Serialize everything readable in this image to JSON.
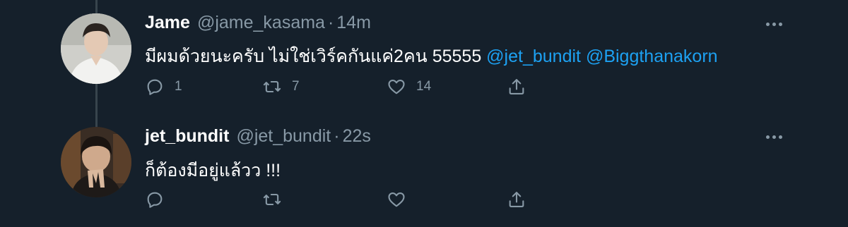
{
  "tweets": [
    {
      "name": "Jame",
      "handle": "@jame_kasama",
      "separator": "·",
      "time": "14m",
      "text_plain": "มีผมด้วยนะครับ ไม่ใช่เวิร์คกันแค่2คน 55555 ",
      "mentions": [
        "@jet_bundit",
        "@Biggthanakorn"
      ],
      "replies": "1",
      "retweets": "7",
      "likes": "14"
    },
    {
      "name": "jet_bundit",
      "handle": "@jet_bundit",
      "separator": "·",
      "time": "22s",
      "text_plain": "ก็ต้องมีอยู่แล้วว !!!",
      "replies": "",
      "retweets": "",
      "likes": ""
    }
  ],
  "icons": {
    "reply": "reply-icon",
    "retweet": "retweet-icon",
    "like": "like-icon",
    "share": "share-icon",
    "more": "more-icon"
  },
  "colors": {
    "background": "#15202b",
    "secondary_text": "#8899a6",
    "link": "#1da1f2",
    "thread_line": "#38444d"
  }
}
